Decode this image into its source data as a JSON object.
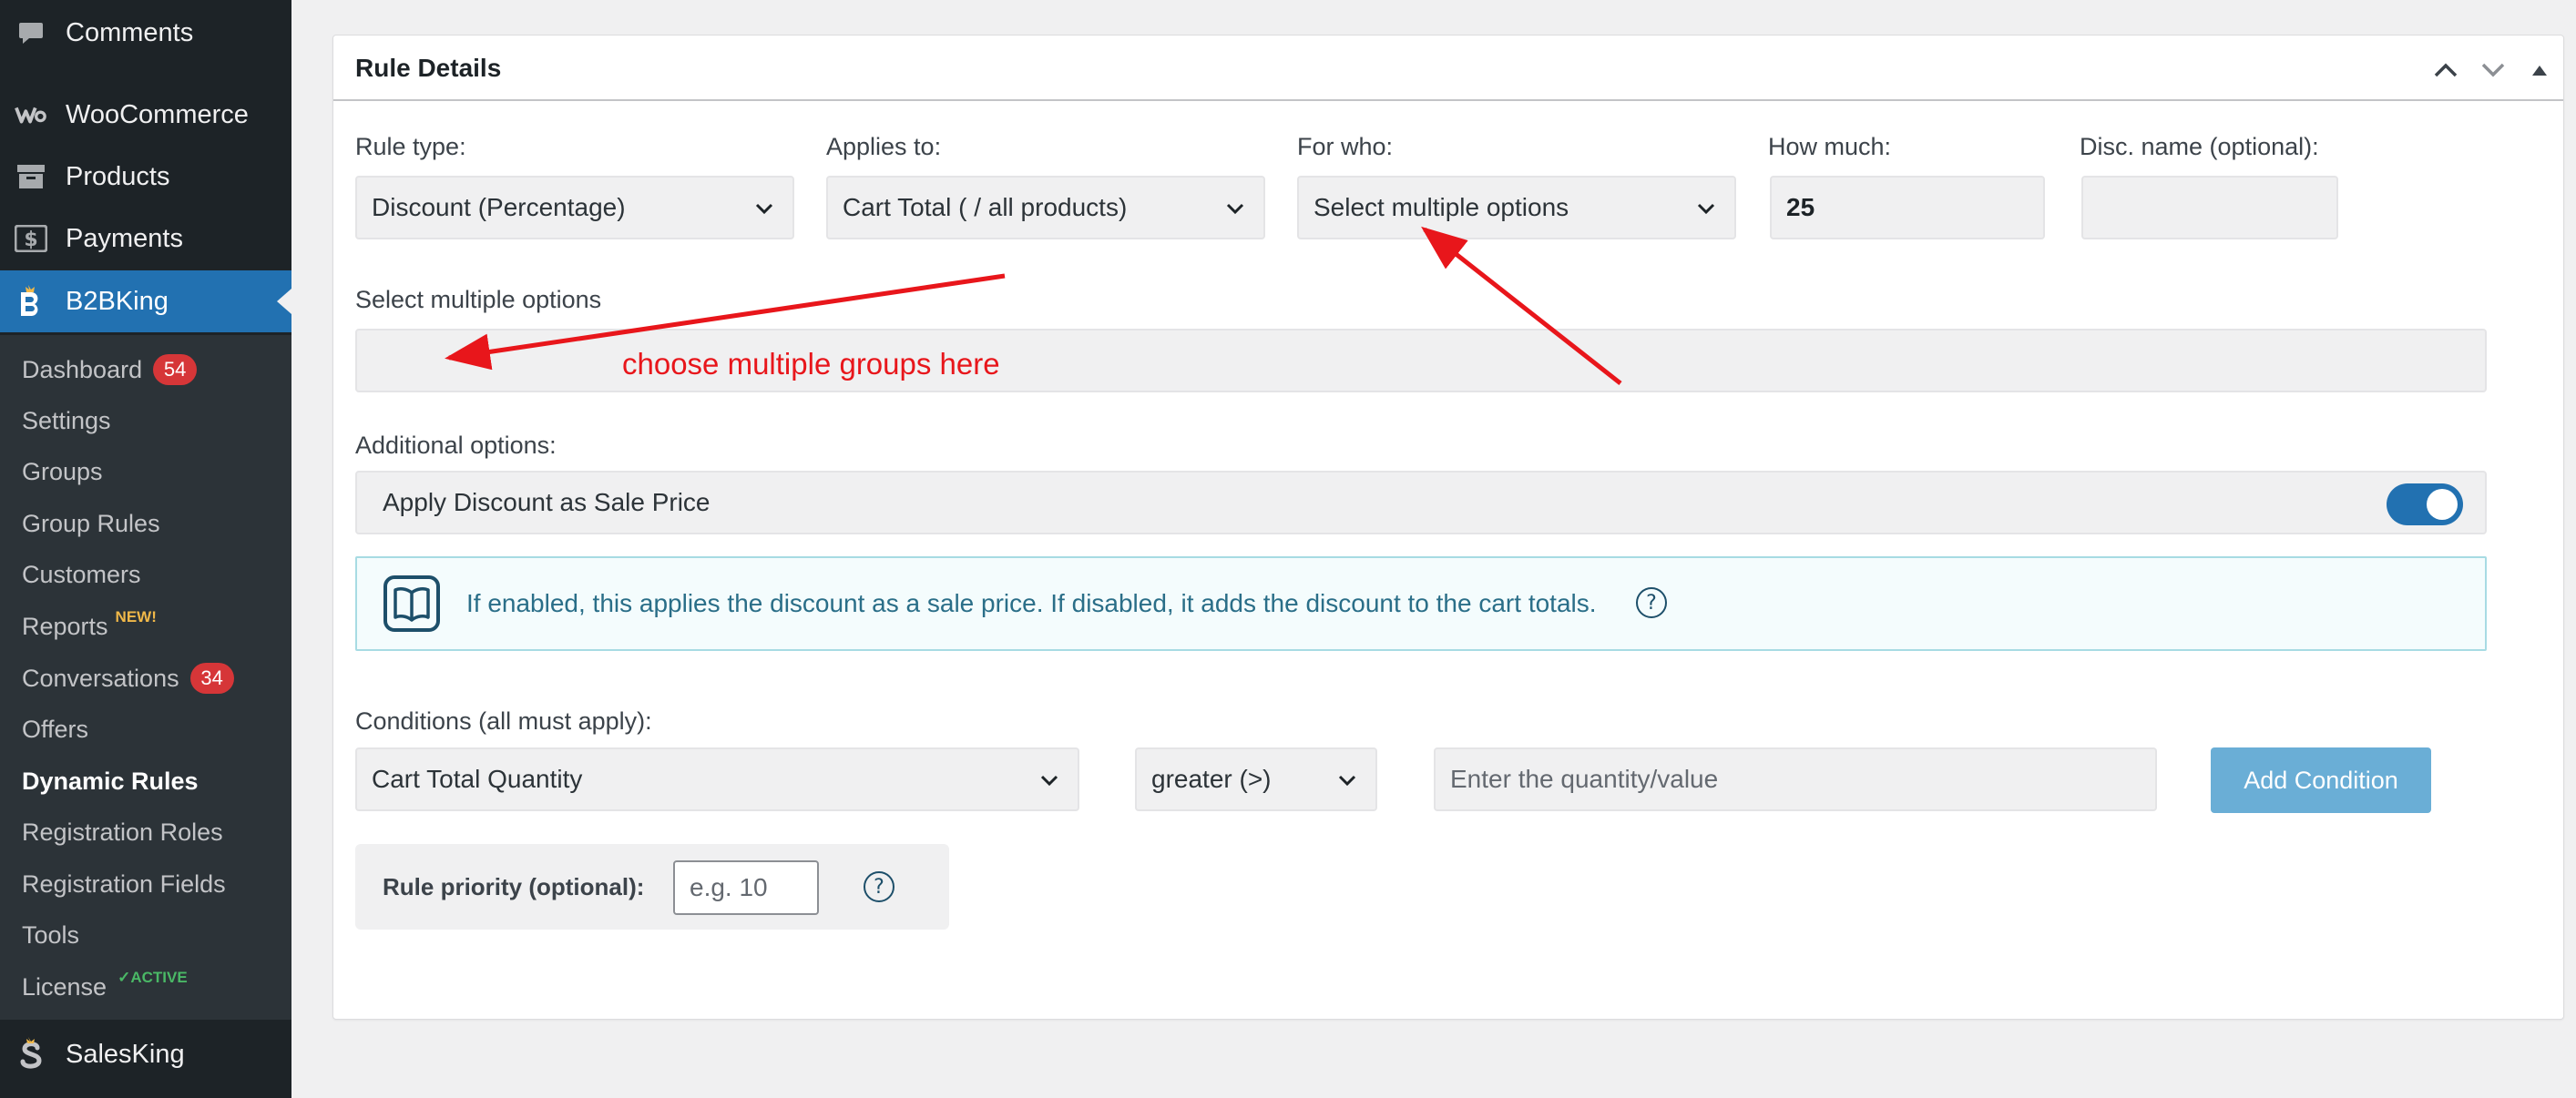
{
  "sidebar": {
    "top_items": [
      {
        "label": "Comments",
        "icon": "comment-icon"
      },
      {
        "label": "WooCommerce",
        "icon": "woocommerce-icon"
      },
      {
        "label": "Products",
        "icon": "archive-icon"
      },
      {
        "label": "Payments",
        "icon": "dollar-icon"
      },
      {
        "label": "B2BKing",
        "icon": "b2bking-icon"
      }
    ],
    "submenu": [
      {
        "label": "Dashboard",
        "badge": "54"
      },
      {
        "label": "Settings"
      },
      {
        "label": "Groups"
      },
      {
        "label": "Group Rules"
      },
      {
        "label": "Customers"
      },
      {
        "label": "Reports",
        "tag": "NEW!"
      },
      {
        "label": "Conversations",
        "badge": "34"
      },
      {
        "label": "Offers"
      },
      {
        "label": "Dynamic Rules"
      },
      {
        "label": "Registration Roles"
      },
      {
        "label": "Registration Fields"
      },
      {
        "label": "Tools"
      },
      {
        "label": "License",
        "tag": "✓ACTIVE"
      }
    ],
    "bottom_item": {
      "label": "SalesKing",
      "icon": "salesking-icon"
    }
  },
  "panel": {
    "title": "Rule Details",
    "rule_type": {
      "label": "Rule type:",
      "value": "Discount (Percentage)"
    },
    "applies_to": {
      "label": "Applies to:",
      "value": "Cart Total ( / all products)"
    },
    "for_who": {
      "label": "For who:",
      "value": "Select multiple options"
    },
    "how_much": {
      "label": "How much:",
      "value": "25"
    },
    "disc_name": {
      "label": "Disc. name (optional):",
      "value": ""
    },
    "multi_select": {
      "label": "Select multiple options"
    },
    "additional": {
      "label": "Additional options:",
      "option_label": "Apply Discount as Sale Price",
      "enabled": true
    },
    "info": {
      "text": "If enabled, this applies the discount as a sale price. If disabled, it adds the discount to the cart totals.",
      "help": "?"
    },
    "conditions": {
      "label": "Conditions (all must apply):",
      "condition_value": "Cart Total Quantity",
      "operator_value": "greater (>)",
      "value_placeholder": "Enter the quantity/value",
      "add_button": "Add Condition"
    },
    "priority": {
      "label": "Rule priority (optional):",
      "placeholder": "e.g. 10",
      "help": "?"
    }
  },
  "annotation": {
    "text": "choose multiple groups here",
    "color": "#e8161b"
  },
  "colors": {
    "accent": "#2271b1",
    "sidebar_bg": "#1d2327",
    "button": "#6aaed6"
  }
}
